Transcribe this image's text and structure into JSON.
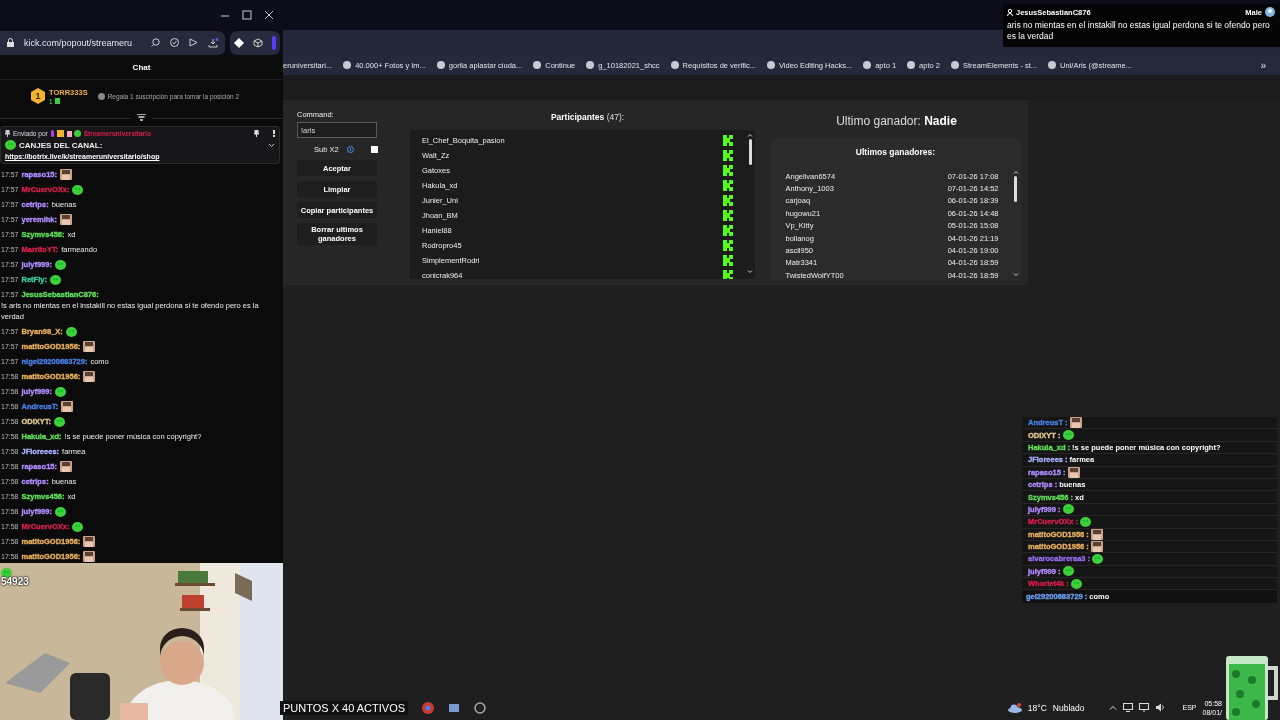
{
  "kick_window": {
    "url": "kick.com/popout/streameru",
    "chat_title": "Chat",
    "leader": {
      "rank": "1",
      "name": "TORR333S",
      "count": "1",
      "hint": "Regala 1 suscripción para tomar la posición 2"
    },
    "pinned": {
      "sent_by": "Enviado por",
      "author": "Streameruniversitario",
      "title": "CANJES DEL CANAL:",
      "link": "https://botrix.live/k/streameruniversitario/shop"
    },
    "messages": [
      {
        "time": "17:57",
        "user": "rapaso15:",
        "color": "#b28cff",
        "kind": "sticker"
      },
      {
        "time": "17:57",
        "user": "MrCuervOXx:",
        "color": "#d81e4a",
        "kind": "emote"
      },
      {
        "time": "17:57",
        "user": "cetrips:",
        "color": "#b28cff",
        "kind": "text",
        "text": "buenas"
      },
      {
        "time": "17:57",
        "user": "yeremihk:",
        "color": "#b28cff",
        "kind": "sticker"
      },
      {
        "time": "17:57",
        "user": "Szymvs456:",
        "color": "#5fe05a",
        "kind": "text",
        "text": "xd"
      },
      {
        "time": "17:57",
        "user": "MarritoYT:",
        "color": "#d81e4a",
        "kind": "text",
        "text": "farmeando"
      },
      {
        "time": "17:57",
        "user": "julyf999:",
        "color": "#b28cff",
        "kind": "emote"
      },
      {
        "time": "17:57",
        "user": "RetFly:",
        "color": "#3fd0a0",
        "kind": "emote"
      },
      {
        "time": "17:57",
        "user": "JesusSebastianC876:",
        "color": "#5fe05a",
        "kind": "text",
        "text": "!s aris no mientas en el instakill no estas igual perdona si te ofendo pero es la verdad"
      },
      {
        "time": "17:57",
        "user": "Bryan98_X:",
        "color": "#e8b060",
        "kind": "emote"
      },
      {
        "time": "17:57",
        "user": "matitoGOD1956:",
        "color": "#e8b060",
        "kind": "sticker"
      },
      {
        "time": "17:57",
        "user": "nigel29200683729:",
        "color": "#4a80e6",
        "kind": "text",
        "text": "como"
      },
      {
        "time": "17:58",
        "user": "matitoGOD1956:",
        "color": "#e8b060",
        "kind": "sticker"
      },
      {
        "time": "17:58",
        "user": "julyf999:",
        "color": "#b28cff",
        "kind": "emote"
      },
      {
        "time": "17:58",
        "user": "AndreusT:",
        "color": "#4a80e6",
        "kind": "sticker"
      },
      {
        "time": "17:58",
        "user": "ODIXYT:",
        "color": "#e0c890",
        "kind": "emote"
      },
      {
        "time": "17:58",
        "user": "Hakula_xd:",
        "color": "#5fe05a",
        "kind": "text",
        "text": "!s se puede poner música con copyright?"
      },
      {
        "time": "17:58",
        "user": "JFloreees:",
        "color": "#a8b4ff",
        "kind": "text",
        "text": "farmea"
      },
      {
        "time": "17:58",
        "user": "rapaso15:",
        "color": "#b28cff",
        "kind": "sticker"
      },
      {
        "time": "17:58",
        "user": "cetrips:",
        "color": "#b28cff",
        "kind": "text",
        "text": "buenas"
      },
      {
        "time": "17:58",
        "user": "Szymvs456:",
        "color": "#5fe05a",
        "kind": "text",
        "text": "xd"
      },
      {
        "time": "17:58",
        "user": "julyf999:",
        "color": "#b28cff",
        "kind": "emote"
      },
      {
        "time": "17:58",
        "user": "MrCuervOXx:",
        "color": "#d81e4a",
        "kind": "emote"
      },
      {
        "time": "17:58",
        "user": "matitoGOD1956:",
        "color": "#e8b060",
        "kind": "sticker"
      },
      {
        "time": "17:58",
        "user": "matitoGOD1956:",
        "color": "#e8b060",
        "kind": "sticker"
      }
    ]
  },
  "cam": {
    "kind": "picture",
    "viewer_count": "54923"
  },
  "bookmarks": [
    {
      "label": "eruniversitari..."
    },
    {
      "label": "40.000+ Fotos y Im..."
    },
    {
      "label": "gorila aplastar ciuda..."
    },
    {
      "label": "Continue"
    },
    {
      "label": "g_10182021_shcc"
    },
    {
      "label": "Requisitos de verific..."
    },
    {
      "label": "Video Editing Hacks..."
    },
    {
      "label": "apto 1"
    },
    {
      "label": "apto 2"
    },
    {
      "label": "StreamElements - st..."
    },
    {
      "label": "Uni/Aris (@streame..."
    }
  ],
  "bookmarks_more": "»",
  "comment_popup": {
    "user": "JesusSebastianC876",
    "gender": "Male",
    "text": "aris no mientas en el instakill no estas igual perdona si te ofendo pero es la verdad"
  },
  "giveaway": {
    "command_label": "Command:",
    "command_value": "!aris",
    "sub_x2": {
      "label": "Sub X2",
      "checked": false
    },
    "buttons": [
      "Aceptar",
      "Limpiar",
      "Copiar participantes",
      "Borrar ultimos ganadores"
    ],
    "participants_title": "**Participantes** (47):",
    "participants": [
      "El_Chef_Boquita_pasion",
      "Walt_Zz",
      "Gatoxes",
      "Hakula_xd",
      "Junier_Uni",
      "Jhoan_BM",
      "Haniel88",
      "Rodropro45",
      "SimplementRodri",
      "conicrak964"
    ],
    "last_winner": "Ultimo ganador: **Nadie**",
    "winners_title": "Ultimos ganadores:",
    "winners": [
      {
        "name": "Angelivan6574",
        "date": "07-01-26 17:08"
      },
      {
        "name": "Anthony_1003",
        "date": "07-01-26 14:52"
      },
      {
        "name": "carjoaq",
        "date": "06-01-26 18:39"
      },
      {
        "name": "hugowu21",
        "date": "06-01-26 14:48"
      },
      {
        "name": "Vp_Kitty",
        "date": "05-01-26 15:08"
      },
      {
        "name": "bollanog",
        "date": "04-01-26 21:19"
      },
      {
        "name": "ascil950",
        "date": "04-01-26 19:00"
      },
      {
        "name": "Matr3341",
        "date": "04-01-26 18:59"
      },
      {
        "name": "TwistedWolfYT00",
        "date": "04-01-26 18:59"
      }
    ]
  },
  "overlay_chat": [
    {
      "user": "AndreusT :",
      "color": "#4a80e6",
      "kind": "sticker"
    },
    {
      "user": "ODIXYT :",
      "color": "#e0c890",
      "kind": "emote"
    },
    {
      "user": "Hakula_xd :",
      "color": "#5fe05a",
      "kind": "text",
      "text": "!s se puede poner música con copyright?"
    },
    {
      "user": "JFloreees :",
      "color": "#a8b4ff",
      "kind": "text",
      "text": "farmea"
    },
    {
      "user": "rapaso15 :",
      "color": "#b28cff",
      "kind": "sticker"
    },
    {
      "user": "cetrips :",
      "color": "#b28cff",
      "kind": "text",
      "text": "buenas"
    },
    {
      "user": "Szymvs456 :",
      "color": "#5fe05a",
      "kind": "text",
      "text": "xd"
    },
    {
      "user": "julyf999 :",
      "color": "#b28cff",
      "kind": "emote"
    },
    {
      "user": "MrCuervOXx :",
      "color": "#d81e4a",
      "kind": "emote"
    },
    {
      "user": "matitoGOD1956 :",
      "color": "#e8b060",
      "kind": "sticker"
    },
    {
      "user": "matitoGOD1956 :",
      "color": "#e8b060",
      "kind": "sticker"
    },
    {
      "user": "alvarocabreraa3 :",
      "color": "#9a6cf0",
      "kind": "emote"
    },
    {
      "user": "julyf999 :",
      "color": "#b28cff",
      "kind": "emote"
    },
    {
      "user": "Whorlet4k :",
      "color": "#d81e4a",
      "kind": "emote"
    },
    {
      "user": "gel29200683729 :",
      "color": "#6aa0f0",
      "kind": "text",
      "text": "como"
    }
  ],
  "taskbar": {
    "banner": "PUNTOS X 40 ACTIVOS",
    "temperature": "18°C",
    "weather": "Nublado",
    "language": "ESP",
    "time": "05:58",
    "date": "08/01/"
  }
}
